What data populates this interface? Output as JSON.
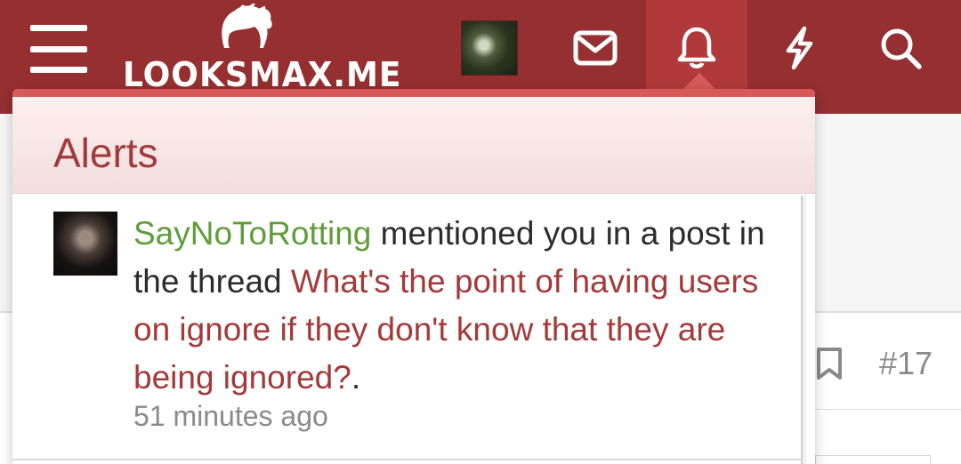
{
  "header": {
    "logo_text": "LOOKSMAX.ME",
    "accent_color": "#952f30",
    "icons": [
      "menu-icon",
      "envelope-icon",
      "bell-icon",
      "bolt-icon",
      "search-icon"
    ]
  },
  "popup": {
    "title": "Alerts",
    "alerts": [
      {
        "username": "SayNoToRotting",
        "action_text": " mentioned you in a post in the thread ",
        "thread_title": "What's the point of having users on ignore if they don't know that they are being ignored?",
        "trailing": ".",
        "time": "51 minutes ago"
      }
    ]
  },
  "background_post": {
    "post_number": "#17"
  }
}
